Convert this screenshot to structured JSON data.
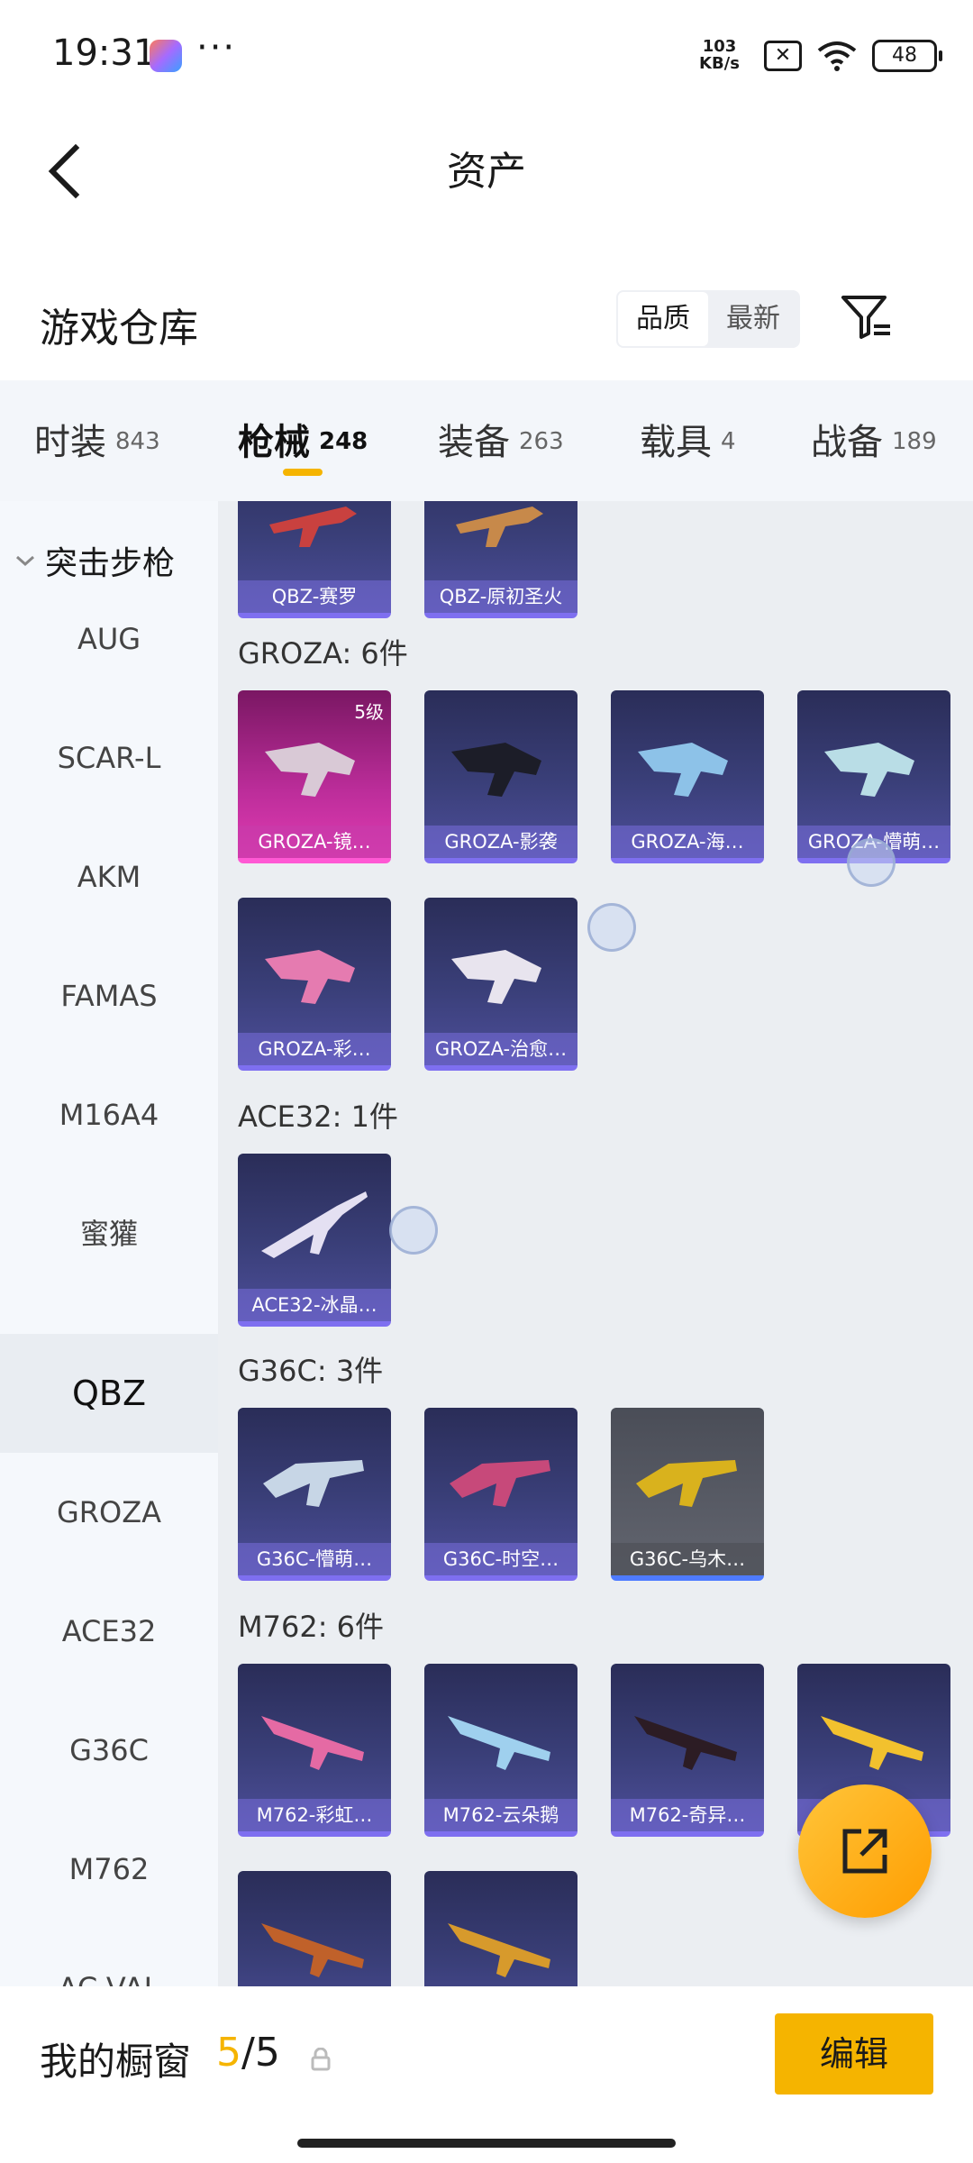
{
  "status_bar": {
    "time": "19:31",
    "more": "···",
    "net_speed_value": "103",
    "net_speed_unit": "KB/s",
    "battery": "48",
    "icons": [
      "game-app-icon",
      "sim-x-icon",
      "wifi-icon",
      "battery-icon"
    ]
  },
  "header": {
    "title": "资产",
    "back_icon": "chevron-left-icon"
  },
  "warehouse": {
    "title": "游戏仓库",
    "sort_options": [
      "品质",
      "最新"
    ],
    "active_sort": "品质",
    "filter_icon": "filter-icon"
  },
  "tabs": [
    {
      "label": "时装",
      "count": "843"
    },
    {
      "label": "枪械",
      "count": "248",
      "active": true
    },
    {
      "label": "装备",
      "count": "263"
    },
    {
      "label": "载具",
      "count": "4"
    },
    {
      "label": "战备",
      "count": "189"
    }
  ],
  "sidebar": {
    "group": "突击步枪",
    "items": [
      "AUG",
      "SCAR-L",
      "AKM",
      "FAMAS",
      "M16A4",
      "蜜獾",
      "QBZ",
      "GROZA",
      "ACE32",
      "G36C",
      "M762",
      "AC-VAL"
    ],
    "active": "QBZ"
  },
  "content": {
    "qbz_cards": [
      "QBZ-赛罗",
      "QBZ-原初圣火"
    ],
    "sections": [
      {
        "title": "GROZA: 6件",
        "cards": [
          "GROZA-镜…",
          "GROZA-影袭",
          "GROZA-海…",
          "GROZA-懵萌…",
          "GROZA-彩…",
          "GROZA-治愈…"
        ],
        "level_badge": "5级"
      },
      {
        "title": "ACE32: 1件",
        "cards": [
          "ACE32-冰晶…"
        ]
      },
      {
        "title": "G36C: 3件",
        "cards": [
          "G36C-懵萌…",
          "G36C-时空…",
          "G36C-乌木…"
        ]
      },
      {
        "title": "M762: 6件",
        "cards": [
          "M762-彩虹…",
          "M762-云朵鹅",
          "M762-奇异…",
          "…"
        ]
      }
    ]
  },
  "fab_icon": "share-export-icon",
  "bottom_bar": {
    "label": "我的橱窗",
    "count_current": "5",
    "count_sep": "/",
    "count_total": "5",
    "edit_label": "编辑"
  },
  "colors": {
    "accent": "#f5b400",
    "card_purple": "#3a3f79",
    "card_pink": "#bc2d9a"
  }
}
